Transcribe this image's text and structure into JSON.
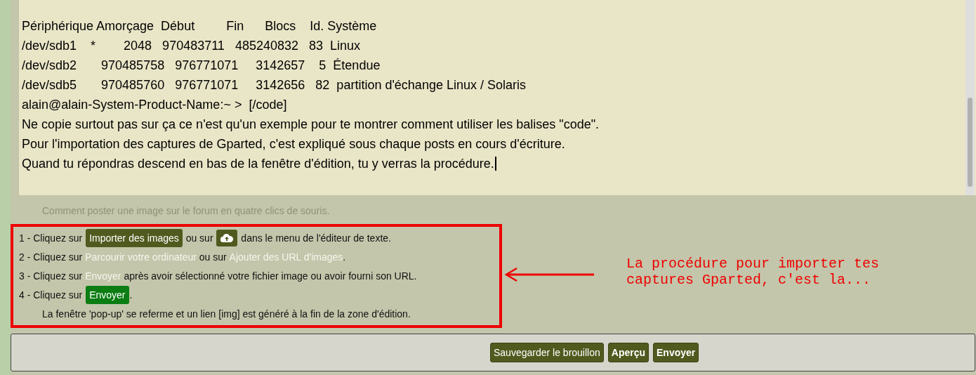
{
  "editor": {
    "lines": [
      "Périphérique Amorçage  Début         Fin      Blocs    Id. Système",
      "/dev/sdb1    *        2048   970483711   485240832   83  Linux",
      "/dev/sdb2       970485758   976771071     3142657    5  Étendue",
      "/dev/sdb5       970485760   976771071     3142656   82  partition d'échange Linux / Solaris",
      "alain@alain-System-Product-Name:~ >  [/code]",
      "Ne copie surtout pas sur ça ce n'est qu'un exemple pour te montrer comment utiliser les balises \"code\".",
      "Pour l'importation des captures de Gparted, c'est expliqué sous chaque posts en cours d'écriture.",
      "Quand tu répondras descend en bas de la fenêtre d'édition, tu y verras la procédure."
    ]
  },
  "help_title": "Comment poster une image sur le forum en quatre clics de souris.",
  "steps": [
    [
      {
        "kind": "text",
        "text": "1 - Cliquez sur "
      },
      {
        "kind": "button",
        "text": "Importer des images"
      },
      {
        "kind": "text",
        "text": " ou sur "
      },
      {
        "kind": "icon-button"
      },
      {
        "kind": "text",
        "text": " dans le menu de l'éditeur de texte."
      }
    ],
    [
      {
        "kind": "text",
        "text": "2 - Cliquez sur "
      },
      {
        "kind": "link",
        "text": "Parcourir votre ordinateur"
      },
      {
        "kind": "text",
        "text": " ou sur "
      },
      {
        "kind": "link",
        "text": "Ajouter des URL d'images"
      },
      {
        "kind": "text",
        "text": "."
      }
    ],
    [
      {
        "kind": "text",
        "text": "3 - Cliquez sur "
      },
      {
        "kind": "link",
        "text": "Envoyer"
      },
      {
        "kind": "text",
        "text": " après avoir sélectionné votre fichier image ou avoir fourni son URL."
      }
    ],
    [
      {
        "kind": "text",
        "text": "4 - Cliquez sur "
      },
      {
        "kind": "green-button",
        "text": "Envoyer"
      },
      {
        "kind": "text",
        "text": "."
      }
    ],
    [
      {
        "kind": "note",
        "text": "La fenêtre 'pop-up' se referme et un lien [img] est généré à la fin de la zone d'édition."
      }
    ]
  ],
  "annotation": "La procédure pour importer tes captures Gparted, c'est la...",
  "buttons": [
    {
      "label": "Sauvegarder le brouillon",
      "bold": false
    },
    {
      "label": "Aperçu",
      "bold": true
    },
    {
      "label": "Envoyer",
      "bold": true
    }
  ]
}
